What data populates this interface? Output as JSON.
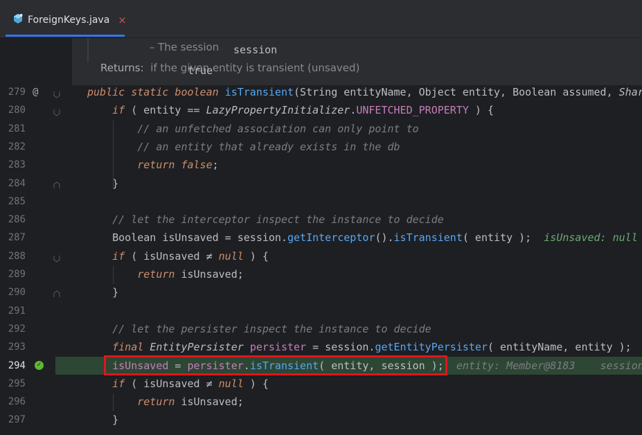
{
  "tab": {
    "filename": "ForeignKeys.java",
    "close": "×"
  },
  "doc": {
    "param_name": "session",
    "param_desc": " – The session",
    "returns_label": "Returns:",
    "returns_code": "true",
    "returns_desc": " if the given entity is transient (unsaved)"
  },
  "lines": [
    {
      "n": "279"
    },
    {
      "n": "280"
    },
    {
      "n": "281"
    },
    {
      "n": "282"
    },
    {
      "n": "283"
    },
    {
      "n": "284"
    },
    {
      "n": "285"
    },
    {
      "n": "286"
    },
    {
      "n": "287"
    },
    {
      "n": "288"
    },
    {
      "n": "289"
    },
    {
      "n": "290"
    },
    {
      "n": "291"
    },
    {
      "n": "292"
    },
    {
      "n": "293"
    },
    {
      "n": "294"
    },
    {
      "n": "295"
    },
    {
      "n": "296"
    },
    {
      "n": "297"
    }
  ],
  "gutter": {
    "override_marker": "@",
    "breakpoint_check": "✓"
  },
  "code": {
    "l279": {
      "kw1": "public static boolean ",
      "fn": "isTransient",
      "rest": "(String entityName, Object entity, Boolean assumed, ",
      "tail": "Shar"
    },
    "l280": {
      "kw": "if",
      "a": " ( entity ",
      "op": "==",
      "b": " ",
      "cls": "LazyPropertyInitializer",
      "c": ".",
      "cst": "UNFETCHED_PROPERTY",
      "d": " ) {"
    },
    "l281": "// an unfetched association can only point to",
    "l282": "// an entity that already exists in the db",
    "l283": {
      "kw": "return false",
      "p": ";"
    },
    "l284": "}",
    "l286": "// let the interceptor inspect the instance to decide",
    "l287": {
      "a": "Boolean ",
      "var": "isUnsaved",
      "b": " = session.",
      "fn1": "getInterceptor",
      "c": "().",
      "fn2": "isTransient",
      "d": "( entity );  ",
      "hint": "isUnsaved: null"
    },
    "l288": {
      "kw": "if",
      "a": " ( isUnsaved ",
      "op": "≠",
      "b": " ",
      "kw2": "null",
      "c": " ) {"
    },
    "l289": {
      "kw": "return",
      "a": " isUnsaved;"
    },
    "l290": "}",
    "l292": "// let the persister inspect the instance to decide",
    "l293": {
      "kw": "final ",
      "cls": "EntityPersister",
      "a": " ",
      "var": "persister",
      "b": " = session.",
      "fn": "getEntityPersister",
      "c": "( entityName, entity );"
    },
    "l294": {
      "var": "isUnsaved",
      "a": " = ",
      "var2": "persister",
      "b": ".",
      "fn": "isTransient",
      "c": "( entity, session );",
      "hint1": "entity: Member@8183",
      "hint2": "session"
    },
    "l295": {
      "kw": "if",
      "a": " ( isUnsaved ",
      "op": "≠",
      "b": " ",
      "kw2": "null",
      "c": " ) {"
    },
    "l296": {
      "kw": "return",
      "a": " isUnsaved;"
    },
    "l297": "}"
  },
  "colors": {
    "keyword": "#cf8e6d",
    "method": "#56a8f5",
    "comment": "#7a7e85",
    "constant": "#c77dbb",
    "execution_line": "#2e4634",
    "highlight_box": "#e0161c",
    "tab_underline": "#3574f0"
  }
}
